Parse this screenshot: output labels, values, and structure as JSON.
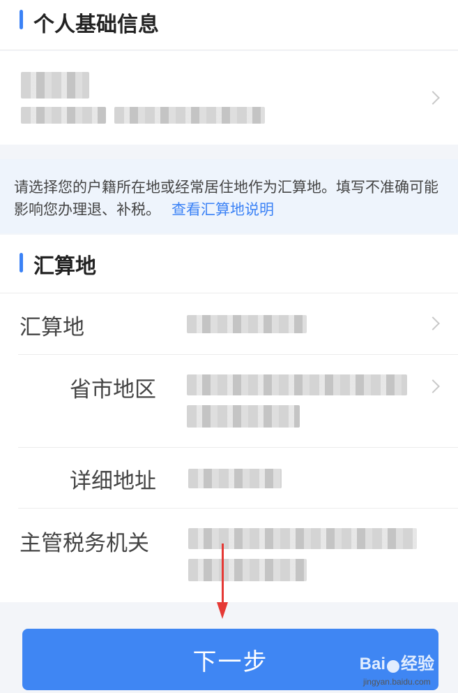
{
  "section_personal": {
    "title": "个人基础信息"
  },
  "notice": {
    "text": "请选择您的户籍所在地或经常居住地作为汇算地。填写不准确可能影响您办理退、补税。",
    "link": "查看汇算地说明"
  },
  "section_settlement": {
    "title": "汇算地",
    "rows": [
      {
        "label": "汇算地"
      },
      {
        "label": "省市地区"
      },
      {
        "label": "详细地址"
      },
      {
        "label": "主管税务机关"
      }
    ]
  },
  "footer": {
    "next_label": "下一步"
  },
  "watermark": {
    "brand": "Bai",
    "brand_suffix": "经验",
    "url": "jingyan.baidu.com"
  },
  "colors": {
    "accent": "#3b82f6",
    "button": "#3f86f3",
    "arrow": "#e53935",
    "notice_bg": "#eef4fc"
  }
}
